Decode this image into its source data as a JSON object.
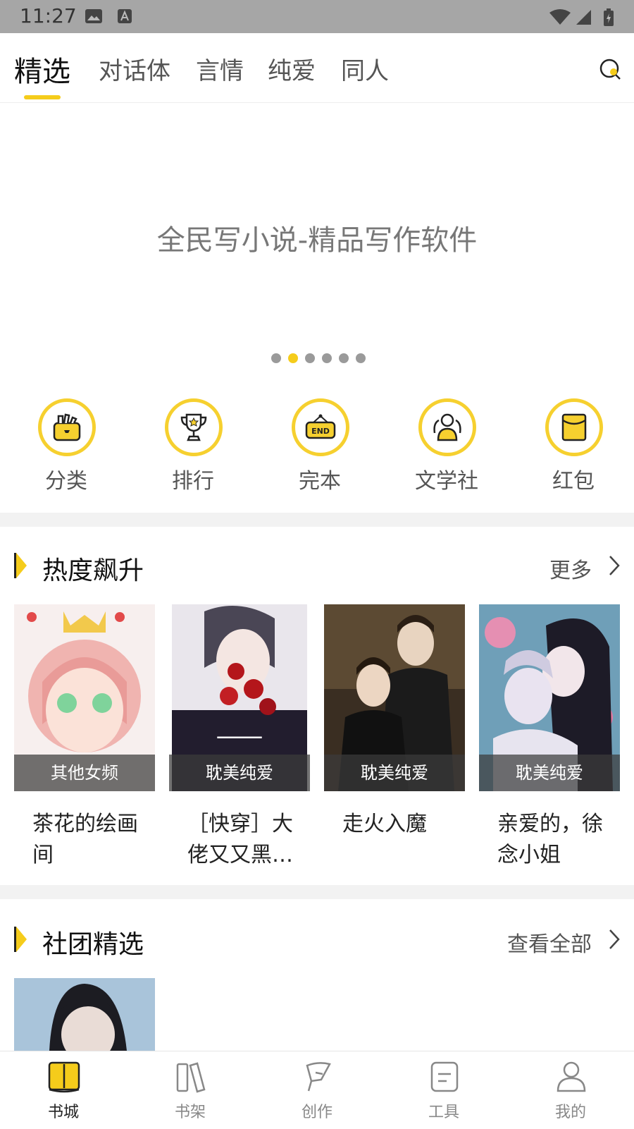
{
  "status_bar": {
    "time": "11:27"
  },
  "tabs": [
    {
      "label": "精选",
      "active": true
    },
    {
      "label": "对话体"
    },
    {
      "label": "言情"
    },
    {
      "label": "纯爱"
    },
    {
      "label": "同人"
    }
  ],
  "banner": {
    "text": "全民写小说-精品写作软件",
    "dot_count": 6,
    "active_dot": 2
  },
  "entries": [
    {
      "label": "分类",
      "icon": "category-bag-icon"
    },
    {
      "label": "排行",
      "icon": "trophy-icon"
    },
    {
      "label": "完本",
      "icon": "end-sign-icon"
    },
    {
      "label": "文学社",
      "icon": "club-people-icon"
    },
    {
      "label": "红包",
      "icon": "red-envelope-icon"
    }
  ],
  "hot_section": {
    "title": "热度飙升",
    "more": "更多",
    "books": [
      {
        "tag": "其他女频",
        "title": "茶花的绘画间"
      },
      {
        "tag": "耽美纯爱",
        "title": "［快穿］大佬又又黑…"
      },
      {
        "tag": "耽美纯爱",
        "title": "走火入魔"
      },
      {
        "tag": "耽美纯爱",
        "title": "亲爱的，徐念小姐"
      }
    ]
  },
  "club_section": {
    "title": "社团精选",
    "more": "查看全部"
  },
  "bottom_nav": [
    {
      "label": "书城",
      "active": true
    },
    {
      "label": "书架"
    },
    {
      "label": "创作"
    },
    {
      "label": "工具"
    },
    {
      "label": "我的"
    }
  ],
  "colors": {
    "accent": "#f5cc1b",
    "status_bar": "#a6a6a6",
    "separator": "#f2f2f2"
  }
}
